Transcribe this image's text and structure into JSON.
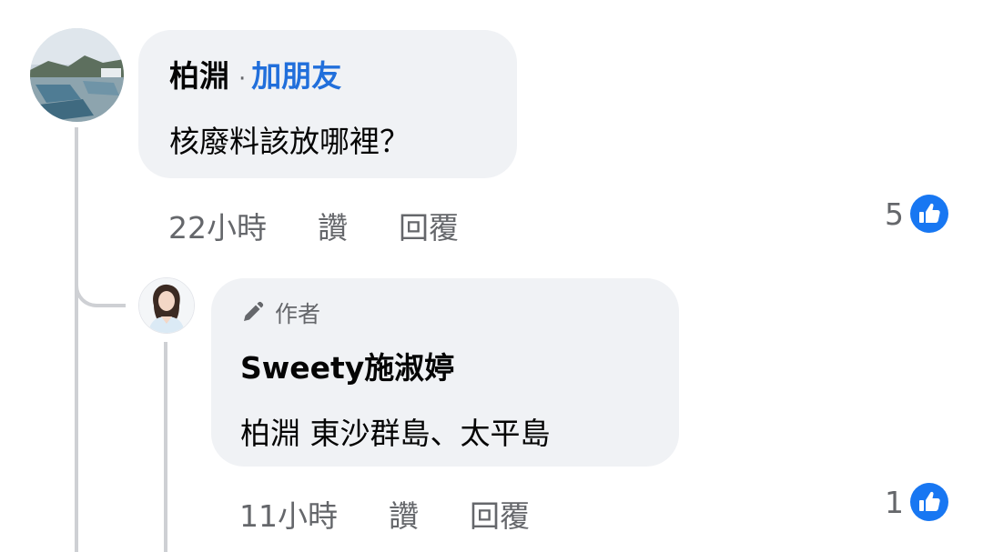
{
  "comment": {
    "author": "柏淵",
    "separator": "·",
    "add_friend": "加朋友",
    "text": "核廢料該放哪裡？",
    "time": "22小時",
    "like_label": "讚",
    "reply_label": "回覆",
    "reaction_count": "5"
  },
  "reply": {
    "badge": "作者",
    "author": "Sweety施淑婷",
    "text": "柏淵 東沙群島、太平島",
    "time": "11小時",
    "like_label": "讚",
    "reply_label": "回覆",
    "reaction_count": "1"
  },
  "colors": {
    "bubble": "#f0f2f5",
    "link_blue": "#216fdb",
    "meta_gray": "#65676b",
    "like_blue": "#1877f2",
    "thread_line": "#ced0d4"
  },
  "icons": [
    "pencil-icon",
    "like-reaction-icon"
  ]
}
